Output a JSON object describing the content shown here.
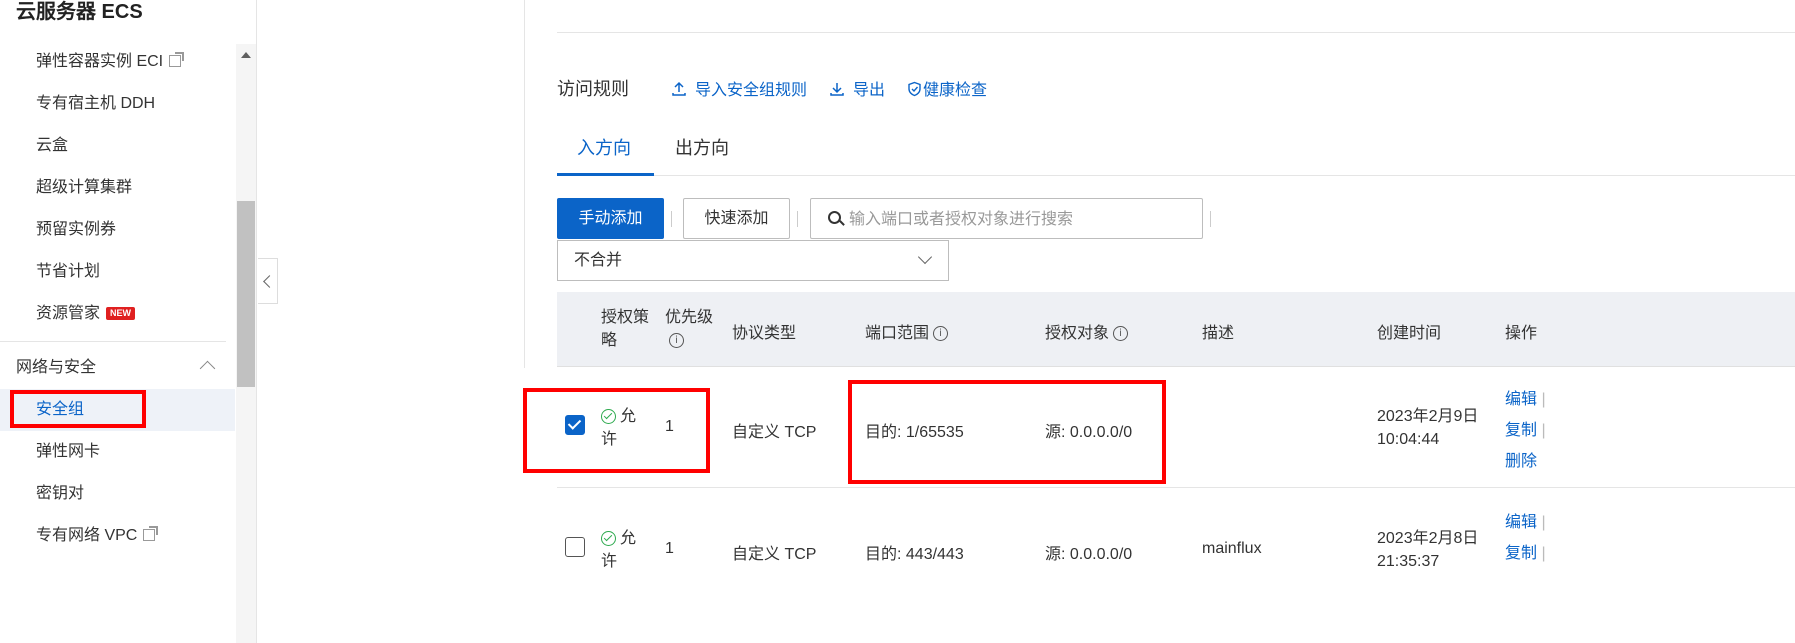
{
  "sidebar": {
    "title": "云服务器 ECS",
    "items": [
      {
        "label": "弹性容器实例 ECI",
        "external": true
      },
      {
        "label": "专有宿主机 DDH"
      },
      {
        "label": "云盒"
      },
      {
        "label": "超级计算集群"
      },
      {
        "label": "预留实例券"
      },
      {
        "label": "节省计划"
      },
      {
        "label": "资源管家",
        "badge": "NEW"
      }
    ],
    "section": {
      "label": "网络与安全",
      "expanded": true
    },
    "section_items": [
      {
        "label": "安全组",
        "active": true
      },
      {
        "label": "弹性网卡"
      },
      {
        "label": "密钥对"
      },
      {
        "label": "专有网络 VPC",
        "external": true
      }
    ]
  },
  "main": {
    "access_rules_label": "访问规则",
    "actions": {
      "import": "导入安全组规则",
      "export": "导出",
      "health": "健康检查"
    },
    "tabs": [
      {
        "label": "入方向",
        "active": true
      },
      {
        "label": "出方向",
        "active": false
      }
    ],
    "toolbar": {
      "manual_add": "手动添加",
      "quick_add": "快速添加",
      "search_placeholder": "输入端口或者授权对象进行搜索",
      "merge_select": "不合并"
    },
    "table": {
      "headers": {
        "policy": "授权策略",
        "priority": "优先级",
        "protocol": "协议类型",
        "port": "端口范围",
        "target": "授权对象",
        "desc": "描述",
        "created": "创建时间",
        "ops": "操作"
      },
      "rows": [
        {
          "checked": true,
          "policy": "允许",
          "priority": "1",
          "protocol": "自定义 TCP",
          "port": "目的: 1/65535",
          "target": "源: 0.0.0.0/0",
          "desc": "",
          "created_date": "2023年2月9日",
          "created_time": "10:04:44",
          "ops": [
            "编辑",
            "复制",
            "删除"
          ]
        },
        {
          "checked": false,
          "policy": "允许",
          "priority": "1",
          "protocol": "自定义 TCP",
          "port": "目的: 443/443",
          "target": "源: 0.0.0.0/0",
          "desc": "mainflux",
          "created_date": "2023年2月8日",
          "created_time": "21:35:37",
          "ops": [
            "编辑",
            "复制"
          ]
        }
      ]
    }
  },
  "colors": {
    "accent": "#0b64c8",
    "highlight_box": "#ff0000",
    "success": "#2eaa4f",
    "badge": "#e02020"
  }
}
